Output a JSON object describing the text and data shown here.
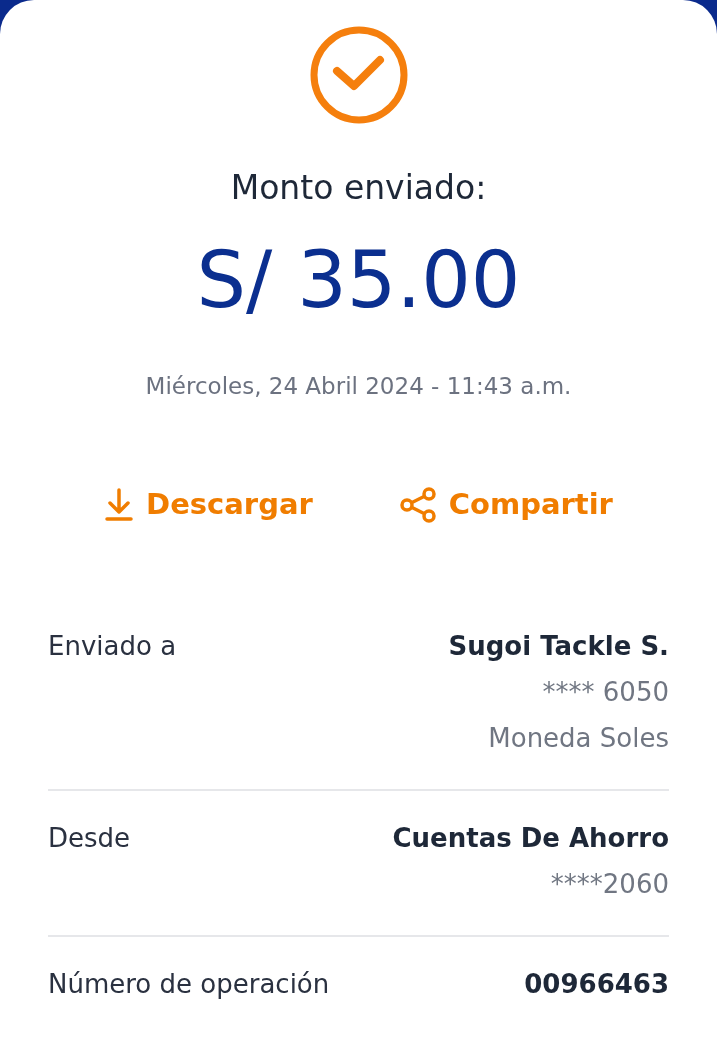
{
  "header": {
    "title": "Monto enviado:",
    "amount": "S/ 35.00",
    "date": "Miércoles, 24 Abril 2024 - 11:43 a.m."
  },
  "actions": [
    {
      "kind": "download",
      "label": "Descargar"
    },
    {
      "kind": "share",
      "label": "Compartir"
    }
  ],
  "details": [
    {
      "label": "Enviado a",
      "values": [
        {
          "text": "Sugoi Tackle S.",
          "bold": true
        },
        {
          "text": "**** 6050",
          "bold": false
        },
        {
          "text": "Moneda Soles",
          "bold": false
        }
      ]
    },
    {
      "label": "Desde",
      "values": [
        {
          "text": "Cuentas De Ahorro",
          "bold": true
        },
        {
          "text": "****2060",
          "bold": false
        }
      ]
    },
    {
      "label": "Número de operación",
      "values": [
        {
          "text": "00966463",
          "bold": true
        }
      ]
    }
  ]
}
